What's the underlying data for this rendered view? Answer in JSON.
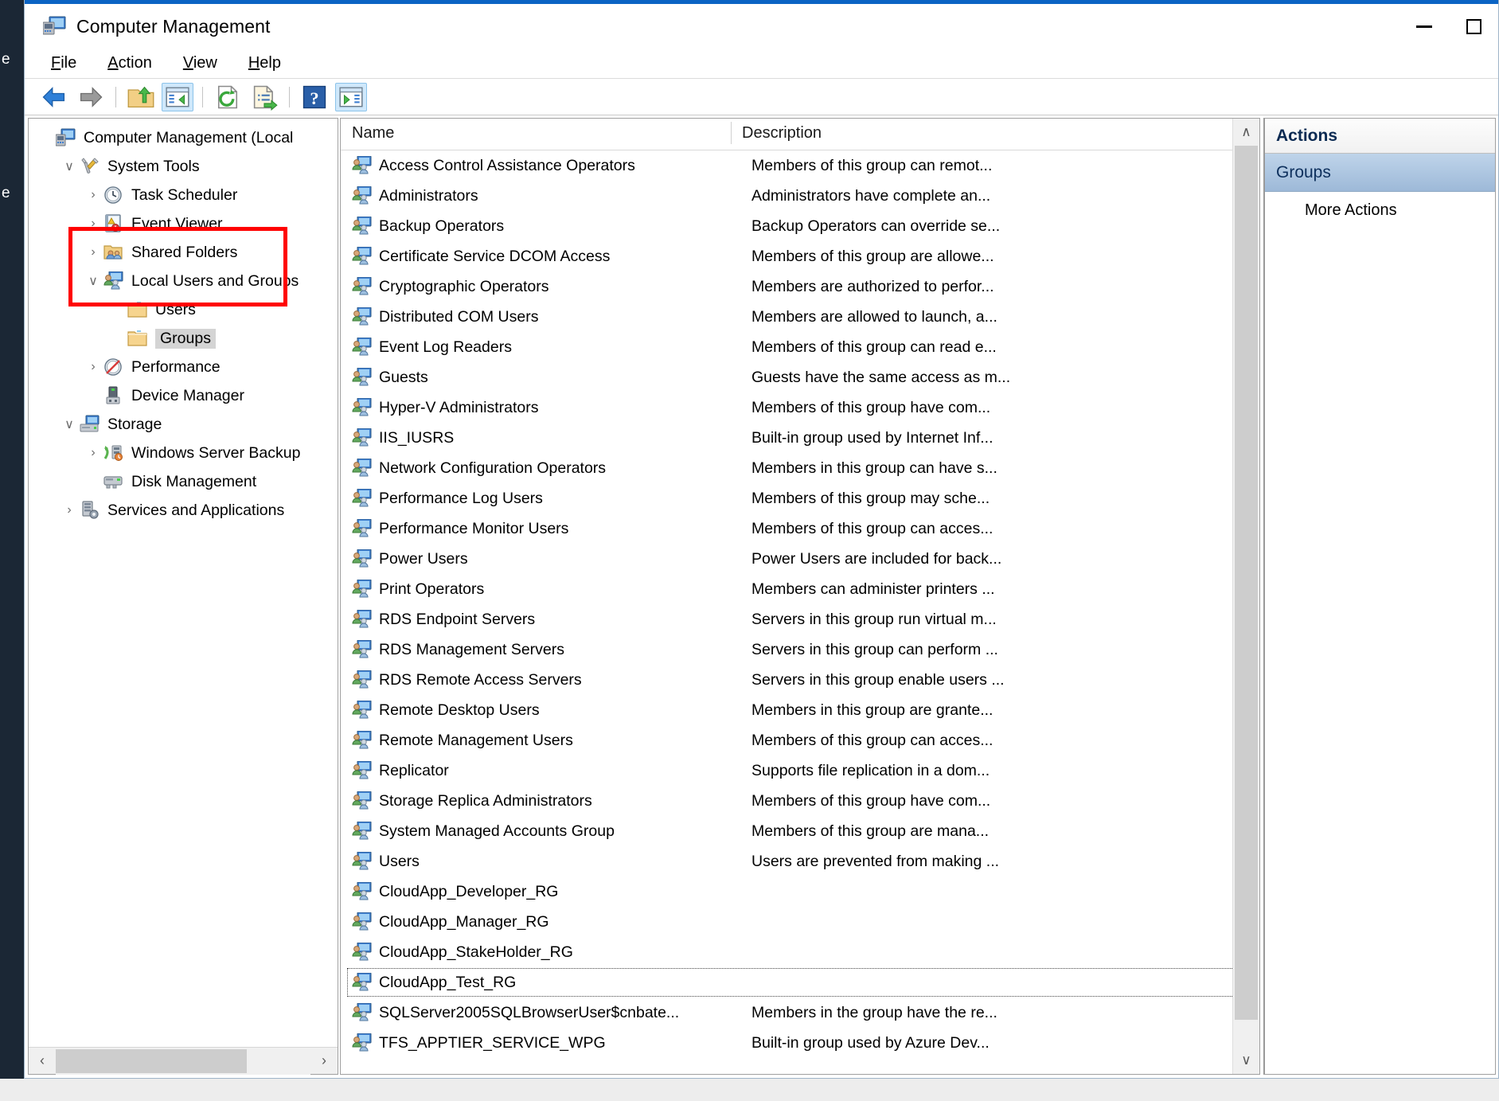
{
  "window": {
    "title": "Computer Management",
    "icon": "computer-management-icon",
    "controls": {
      "minimize": "—",
      "maximize": "□"
    }
  },
  "desktop": {
    "edge_letters": [
      "e",
      "e"
    ]
  },
  "menu": [
    {
      "label": "File",
      "accel": "F"
    },
    {
      "label": "Action",
      "accel": "A"
    },
    {
      "label": "View",
      "accel": "V"
    },
    {
      "label": "Help",
      "accel": "H"
    }
  ],
  "toolbar": [
    {
      "name": "back-button",
      "icon": "back-arrow-icon",
      "active": false
    },
    {
      "name": "forward-button",
      "icon": "forward-arrow-icon",
      "active": false
    },
    {
      "name": "separator-1",
      "icon": "separator",
      "active": false
    },
    {
      "name": "up-one-level-button",
      "icon": "folder-up-icon",
      "active": false
    },
    {
      "name": "show-hide-console-tree-button",
      "icon": "console-tree-icon",
      "active": true
    },
    {
      "name": "separator-2",
      "icon": "separator",
      "active": false
    },
    {
      "name": "refresh-button",
      "icon": "refresh-icon",
      "active": false
    },
    {
      "name": "export-list-button",
      "icon": "export-list-icon",
      "active": false
    },
    {
      "name": "separator-3",
      "icon": "separator",
      "active": false
    },
    {
      "name": "help-button",
      "icon": "help-icon",
      "active": false
    },
    {
      "name": "show-hide-action-pane-button",
      "icon": "action-pane-icon",
      "active": true
    }
  ],
  "tree": {
    "nodes": [
      {
        "label": "Computer Management (Local",
        "indent": 0,
        "twist": "",
        "icon": "computer-management-icon",
        "selected": false
      },
      {
        "label": "System Tools",
        "indent": 1,
        "twist": "∨",
        "icon": "system-tools-icon",
        "selected": false
      },
      {
        "label": "Task Scheduler",
        "indent": 2,
        "twist": "›",
        "icon": "clock-icon",
        "selected": false
      },
      {
        "label": "Event Viewer",
        "indent": 2,
        "twist": "›",
        "icon": "event-viewer-icon",
        "selected": false
      },
      {
        "label": "Shared Folders",
        "indent": 2,
        "twist": "›",
        "icon": "shared-folders-icon",
        "selected": false
      },
      {
        "label": "Local Users and Groups",
        "indent": 2,
        "twist": "∨",
        "icon": "local-users-groups-icon",
        "selected": false
      },
      {
        "label": "Users",
        "indent": 3,
        "twist": "",
        "icon": "folder-icon",
        "selected": false
      },
      {
        "label": "Groups",
        "indent": 3,
        "twist": "",
        "icon": "folder-icon",
        "selected": true
      },
      {
        "label": "Performance",
        "indent": 2,
        "twist": "›",
        "icon": "performance-icon",
        "selected": false
      },
      {
        "label": "Device Manager",
        "indent": 2,
        "twist": "",
        "icon": "device-manager-icon",
        "selected": false
      },
      {
        "label": "Storage",
        "indent": 1,
        "twist": "∨",
        "icon": "storage-icon",
        "selected": false
      },
      {
        "label": "Windows Server Backup",
        "indent": 2,
        "twist": "›",
        "icon": "server-backup-icon",
        "selected": false
      },
      {
        "label": "Disk Management",
        "indent": 2,
        "twist": "",
        "icon": "disk-management-icon",
        "selected": false
      },
      {
        "label": "Services and Applications",
        "indent": 1,
        "twist": "›",
        "icon": "services-apps-icon",
        "selected": false
      }
    ],
    "hscroll": {
      "left_arrow": "‹",
      "right_arrow": "›"
    }
  },
  "list": {
    "columns": [
      "Name",
      "Description"
    ],
    "scroll": {
      "up_arrow": "∧",
      "down_arrow": "∨"
    },
    "rows": [
      {
        "name": "Access Control Assistance Operators",
        "description": "Members of this group can remot...",
        "focused": false
      },
      {
        "name": "Administrators",
        "description": "Administrators have complete an...",
        "focused": false
      },
      {
        "name": "Backup Operators",
        "description": "Backup Operators can override se...",
        "focused": false
      },
      {
        "name": "Certificate Service DCOM Access",
        "description": "Members of this group are allowe...",
        "focused": false
      },
      {
        "name": "Cryptographic Operators",
        "description": "Members are authorized to perfor...",
        "focused": false
      },
      {
        "name": "Distributed COM Users",
        "description": "Members are allowed to launch, a...",
        "focused": false
      },
      {
        "name": "Event Log Readers",
        "description": "Members of this group can read e...",
        "focused": false
      },
      {
        "name": "Guests",
        "description": "Guests have the same access as m...",
        "focused": false
      },
      {
        "name": "Hyper-V Administrators",
        "description": "Members of this group have com...",
        "focused": false
      },
      {
        "name": "IIS_IUSRS",
        "description": "Built-in group used by Internet Inf...",
        "focused": false
      },
      {
        "name": "Network Configuration Operators",
        "description": "Members in this group can have s...",
        "focused": false
      },
      {
        "name": "Performance Log Users",
        "description": "Members of this group may sche...",
        "focused": false
      },
      {
        "name": "Performance Monitor Users",
        "description": "Members of this group can acces...",
        "focused": false
      },
      {
        "name": "Power Users",
        "description": "Power Users are included for back...",
        "focused": false
      },
      {
        "name": "Print Operators",
        "description": "Members can administer printers ...",
        "focused": false
      },
      {
        "name": "RDS Endpoint Servers",
        "description": "Servers in this group run virtual m...",
        "focused": false
      },
      {
        "name": "RDS Management Servers",
        "description": "Servers in this group can perform ...",
        "focused": false
      },
      {
        "name": "RDS Remote Access Servers",
        "description": "Servers in this group enable users ...",
        "focused": false
      },
      {
        "name": "Remote Desktop Users",
        "description": "Members in this group are grante...",
        "focused": false
      },
      {
        "name": "Remote Management Users",
        "description": "Members of this group can acces...",
        "focused": false
      },
      {
        "name": "Replicator",
        "description": "Supports file replication in a dom...",
        "focused": false
      },
      {
        "name": "Storage Replica Administrators",
        "description": "Members of this group have com...",
        "focused": false
      },
      {
        "name": "System Managed Accounts Group",
        "description": "Members of this group are mana...",
        "focused": false
      },
      {
        "name": "Users",
        "description": "Users are prevented from making ...",
        "focused": false
      },
      {
        "name": "CloudApp_Developer_RG",
        "description": "",
        "focused": false
      },
      {
        "name": "CloudApp_Manager_RG",
        "description": "",
        "focused": false
      },
      {
        "name": "CloudApp_StakeHolder_RG",
        "description": "",
        "focused": false
      },
      {
        "name": "CloudApp_Test_RG",
        "description": "",
        "focused": true
      },
      {
        "name": "SQLServer2005SQLBrowserUser$cnbate...",
        "description": "Members in the group have the re...",
        "focused": false
      },
      {
        "name": "TFS_APPTIER_SERVICE_WPG",
        "description": "Built-in group used by Azure Dev...",
        "focused": false
      }
    ]
  },
  "actions": {
    "header": "Actions",
    "group_label": "Groups",
    "items": [
      {
        "label": "More Actions"
      }
    ]
  },
  "annotation": {
    "color": "#ff0000",
    "targets": [
      "Local Users and Groups",
      "Users",
      "Groups"
    ]
  }
}
